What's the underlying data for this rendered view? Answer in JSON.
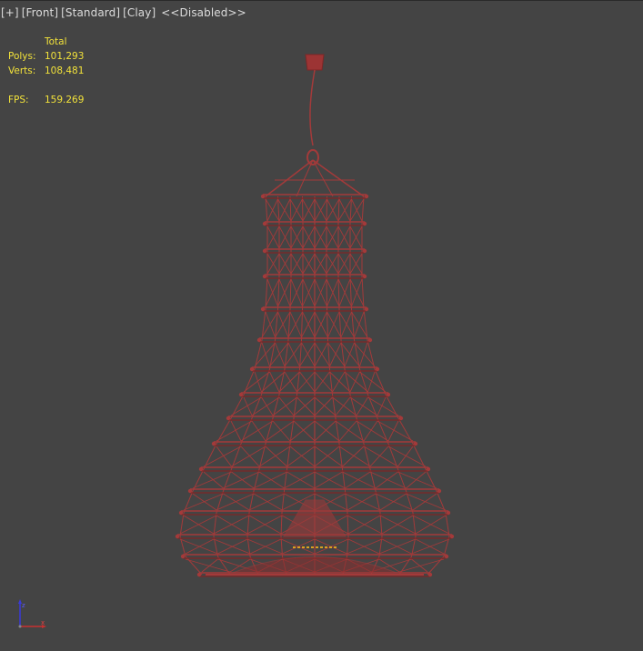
{
  "viewport": {
    "labels": {
      "plus": "[+]",
      "view": "[Front]",
      "shading": "[Standard]",
      "style": "[Clay]",
      "disabled": "<<Disabled>>"
    },
    "stats": {
      "header": "Total",
      "polys_label": "Polys:",
      "polys_value": "101,293",
      "verts_label": "Verts:",
      "verts_value": "108,481",
      "fps_label": "FPS:",
      "fps_value": "159.269"
    },
    "colors": {
      "background": "#444444",
      "stats_text": "#f2e23a",
      "wire": "#a33a3a",
      "wire_dark": "#7e2626"
    },
    "icons": {
      "model": "pendant-lamp-wireframe",
      "axis": "axis-gizmo-icon"
    }
  }
}
